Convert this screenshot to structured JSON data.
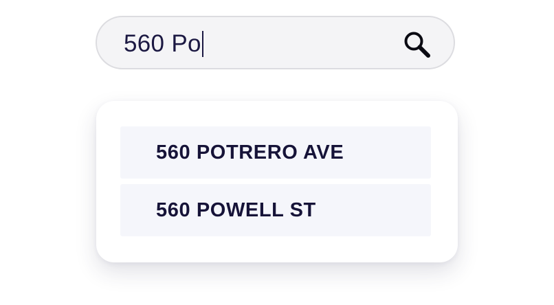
{
  "search": {
    "value": "560 Po"
  },
  "suggestions": [
    {
      "label": "560 POTRERO AVE"
    },
    {
      "label": "560 POWELL ST"
    }
  ],
  "icons": {
    "search": "search-icon"
  },
  "colors": {
    "text_primary": "#1b1842",
    "input_background": "#f4f4f6",
    "input_border": "#dcdce0",
    "suggestion_background": "#f5f6fb"
  }
}
